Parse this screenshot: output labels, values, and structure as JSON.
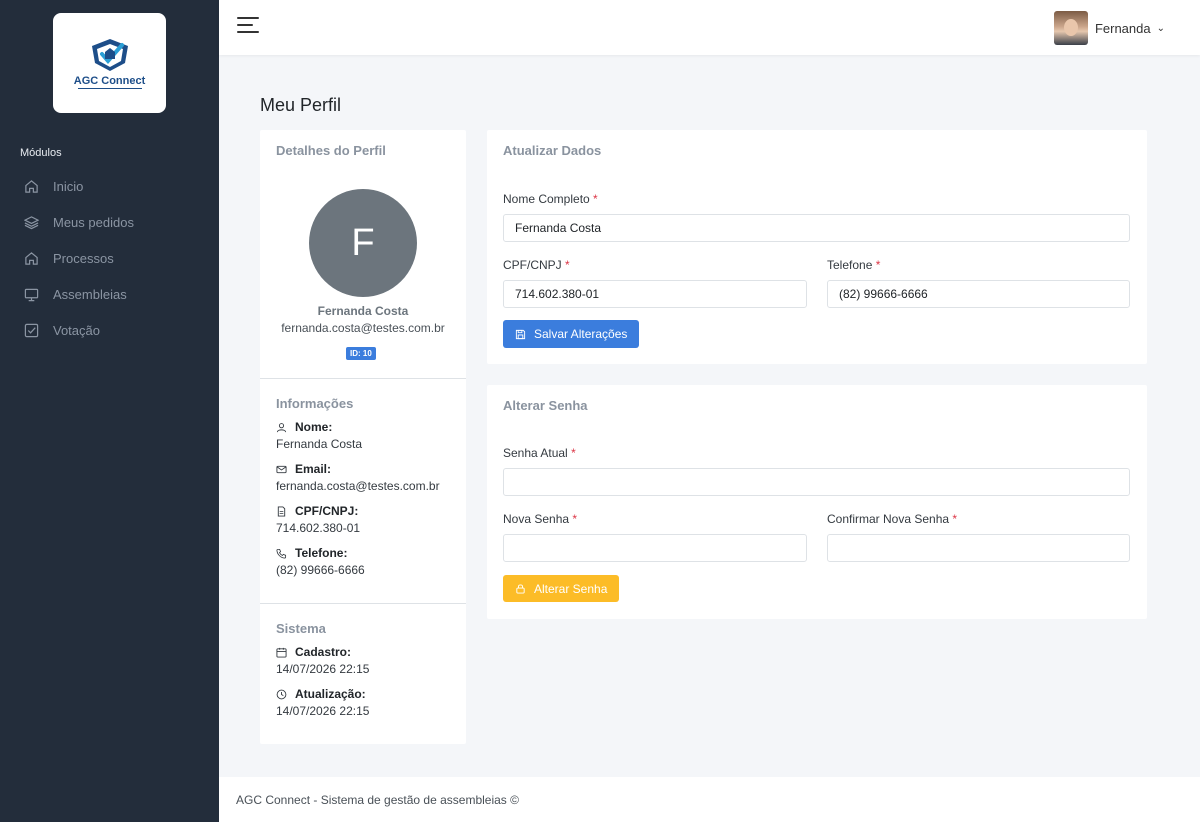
{
  "brand": {
    "name": "AGC Connect"
  },
  "sidebar": {
    "section_title": "Módulos",
    "items": [
      {
        "label": "Inicio",
        "icon": "home-icon"
      },
      {
        "label": "Meus pedidos",
        "icon": "layers-icon"
      },
      {
        "label": "Processos",
        "icon": "home-icon"
      },
      {
        "label": "Assembleias",
        "icon": "monitor-icon"
      },
      {
        "label": "Votação",
        "icon": "check-square-icon"
      }
    ]
  },
  "topbar": {
    "user_name": "Fernanda"
  },
  "page": {
    "title": "Meu Perfil"
  },
  "profile": {
    "card_title": "Detalhes do Perfil",
    "initial": "F",
    "name": "Fernanda Costa",
    "email": "fernanda.costa@testes.com.br",
    "id_badge": "ID: 10"
  },
  "info": {
    "title": "Informações",
    "fields": [
      {
        "label": "Nome:",
        "value": "Fernanda Costa"
      },
      {
        "label": "Email:",
        "value": "fernanda.costa@testes.com.br"
      },
      {
        "label": "CPF/CNPJ:",
        "value": "714.602.380-01"
      },
      {
        "label": "Telefone:",
        "value": "(82) 99666-6666"
      }
    ]
  },
  "system": {
    "title": "Sistema",
    "fields": [
      {
        "label": "Cadastro:",
        "value": "14/07/2026 22:15"
      },
      {
        "label": "Atualização:",
        "value": "14/07/2026 22:15"
      }
    ]
  },
  "update_form": {
    "title": "Atualizar Dados",
    "full_name_label": "Nome Completo",
    "full_name_value": "Fernanda Costa",
    "cpf_label": "CPF/CNPJ",
    "cpf_value": "714.602.380-01",
    "phone_label": "Telefone",
    "phone_value": "(82) 99666-6666",
    "save_label": "Salvar Alterações"
  },
  "password_form": {
    "title": "Alterar Senha",
    "current_label": "Senha Atual",
    "new_label": "Nova Senha",
    "confirm_label": "Confirmar Nova Senha",
    "submit_label": "Alterar Senha"
  },
  "required_mark": "*",
  "footer": {
    "text": "AGC Connect - Sistema de gestão de assembleias ©"
  },
  "colors": {
    "sidebar_bg": "#232d3b",
    "primary": "#3b7ddd",
    "warning": "#fcbc27",
    "required": "#dc3545"
  }
}
